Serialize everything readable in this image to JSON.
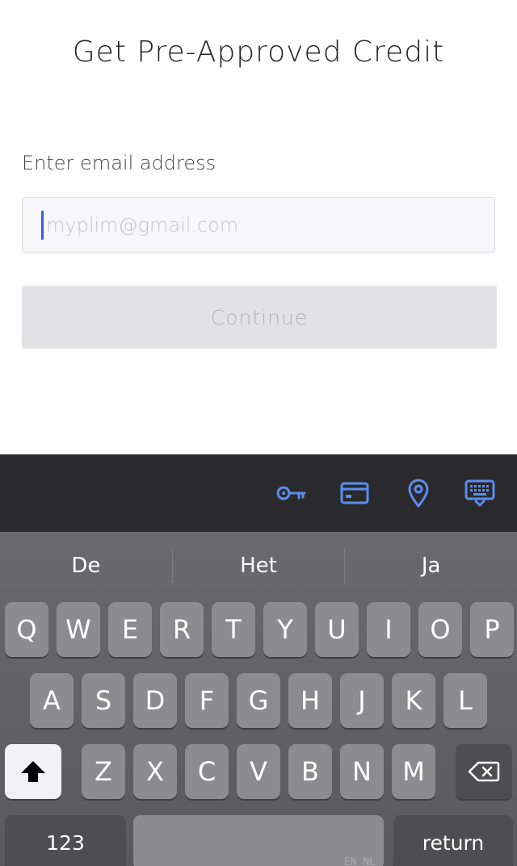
{
  "header": {
    "title": "Get Pre-Approved Credit"
  },
  "form": {
    "email_label": "Enter email address",
    "email_placeholder": "myplim@gmail.com",
    "email_value": "",
    "continue_label": "Continue"
  },
  "keyboard_toolbar": {
    "icons": [
      "key-icon",
      "credit-card-icon",
      "location-pin-icon",
      "keyboard-dismiss-icon"
    ],
    "accent_color": "#5b8def"
  },
  "keyboard": {
    "suggestions": [
      "De",
      "Het",
      "Ja"
    ],
    "row1": [
      "Q",
      "W",
      "E",
      "R",
      "T",
      "Y",
      "U",
      "I",
      "O",
      "P"
    ],
    "row2": [
      "A",
      "S",
      "D",
      "F",
      "G",
      "H",
      "J",
      "K",
      "L"
    ],
    "row3": [
      "Z",
      "X",
      "C",
      "V",
      "B",
      "N",
      "M"
    ],
    "numbers_label": "123",
    "return_label": "return",
    "space_hint": "EN NL"
  }
}
